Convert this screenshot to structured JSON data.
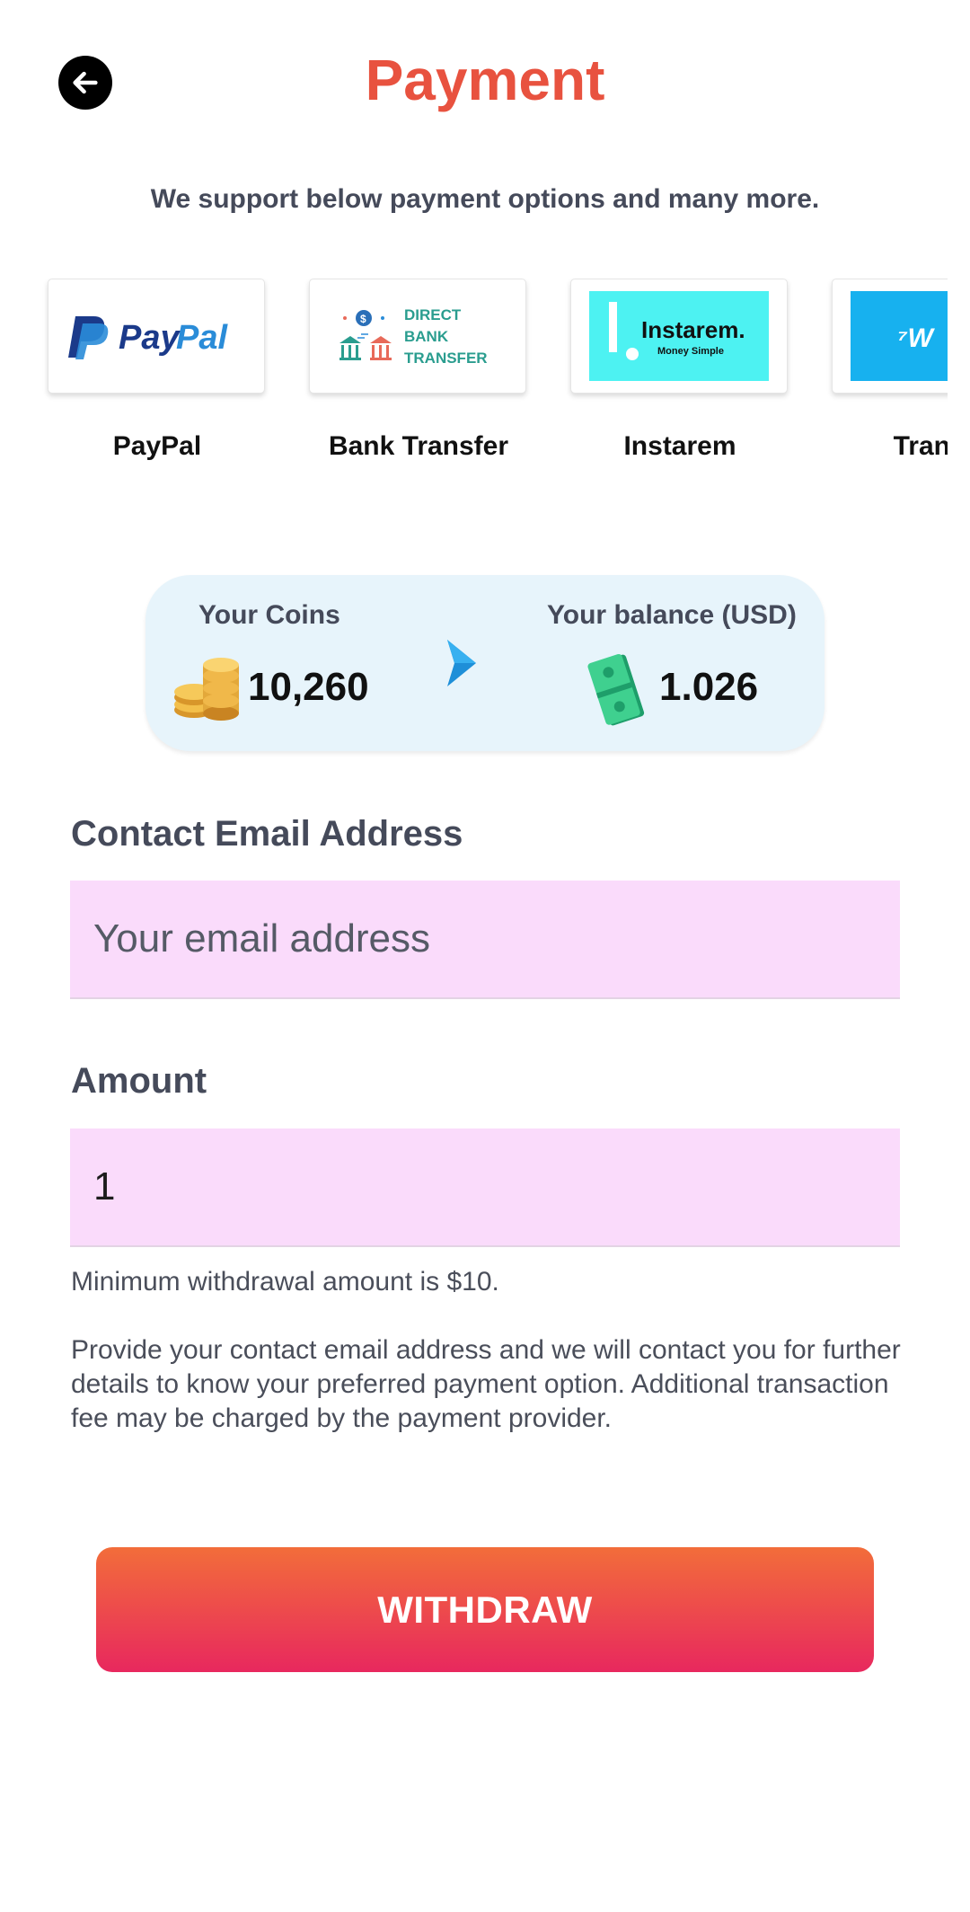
{
  "header": {
    "title": "Payment",
    "back_icon": "arrow-left-icon"
  },
  "subtitle": "We support below payment options and many more.",
  "payment_methods": [
    {
      "label": "PayPal",
      "logo": "paypal-logo"
    },
    {
      "label": "Bank Transfer",
      "logo": "direct-bank-transfer-logo",
      "logo_text": "DIRECT BANK TRANSFER"
    },
    {
      "label": "Instarem",
      "logo": "instarem-logo",
      "logo_text": "Instarem.",
      "logo_subtext": "Money Simple"
    },
    {
      "label": "Transfe",
      "logo": "wise-logo"
    }
  ],
  "balance": {
    "coins_label": "Your Coins",
    "coins_value": "10,260",
    "usd_label": "Your balance (USD)",
    "usd_value": "1.026",
    "arrow_icon": "chevron-right-icon"
  },
  "form": {
    "email_label": "Contact Email Address",
    "email_placeholder": "Your email address",
    "email_value": "",
    "amount_label": "Amount",
    "amount_value": "1",
    "min_note": "Minimum withdrawal amount is $10.",
    "info_note": "Provide your contact email address and we will contact you for further details to know your preferred payment option. Additional transaction fee may be charged by the payment provider."
  },
  "withdraw_button": "WITHDRAW",
  "colors": {
    "title": "#e8523f",
    "input_bg": "#fadbfb",
    "balance_bg": "#e7f4fb",
    "button_top": "#f26d3a",
    "button_bottom": "#e8285e"
  }
}
